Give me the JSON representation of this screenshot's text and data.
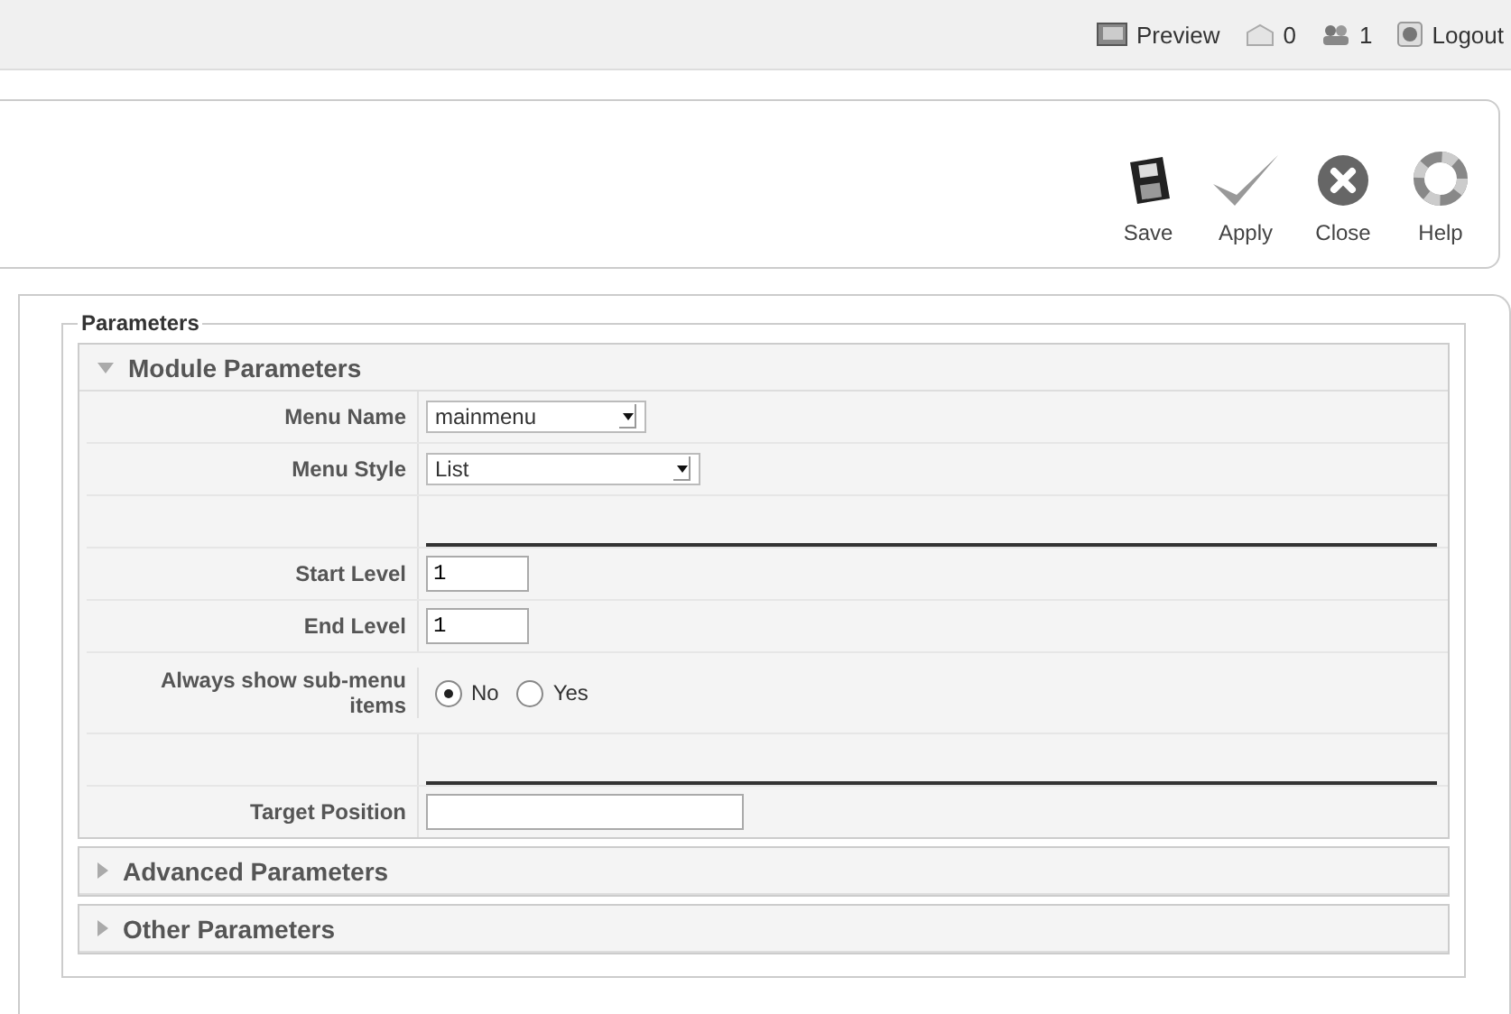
{
  "header_links": [
    {
      "kind": "preview",
      "label": "Preview"
    },
    {
      "kind": "messages",
      "label": "0"
    },
    {
      "kind": "users",
      "label": "1"
    },
    {
      "kind": "logout",
      "label": "Logout"
    }
  ],
  "toolbar": [
    {
      "kind": "save",
      "label": "Save"
    },
    {
      "kind": "apply",
      "label": "Apply"
    },
    {
      "kind": "close",
      "label": "Close"
    },
    {
      "kind": "help",
      "label": "Help"
    }
  ],
  "fieldset": {
    "legend": "Parameters",
    "panels": [
      {
        "title": "Module Parameters",
        "expanded": true,
        "params": [
          {
            "kind": "list",
            "label": "Menu Name",
            "value": "mainmenu"
          },
          {
            "kind": "list",
            "label": "Menu Style",
            "value": "List"
          },
          {
            "kind": "spacer"
          },
          {
            "kind": "text",
            "label": "Start Level",
            "value": "1"
          },
          {
            "kind": "text",
            "label": "End Level",
            "value": "1"
          },
          {
            "kind": "radio",
            "label": "Always show sub-menu items",
            "options": [
              {
                "label": "No",
                "selected": true
              },
              {
                "label": "Yes",
                "selected": false
              }
            ]
          },
          {
            "kind": "spacer"
          },
          {
            "kind": "text",
            "label": "Target Position"
          }
        ]
      },
      {
        "title": "Advanced Parameters",
        "expanded": false
      },
      {
        "title": "Other Parameters",
        "expanded": false
      }
    ]
  }
}
